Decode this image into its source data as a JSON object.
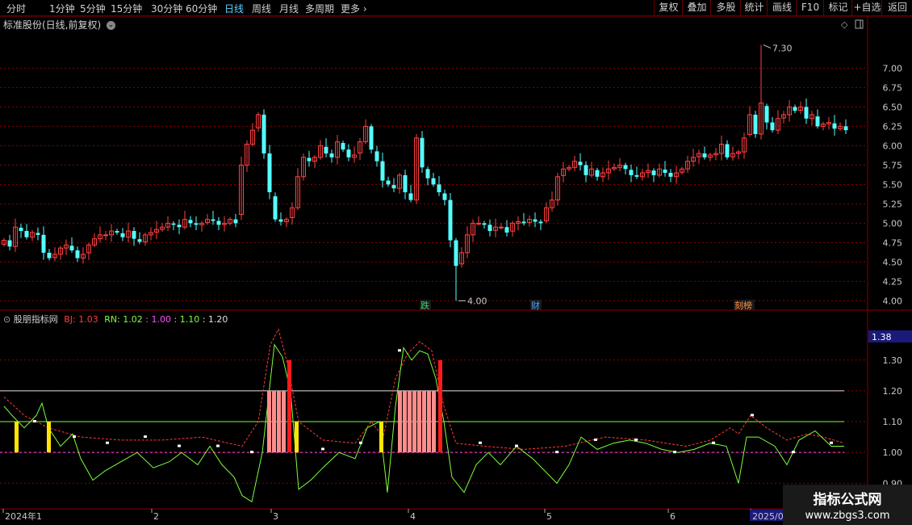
{
  "toolbar": {
    "periods": [
      "分时",
      "1分钟",
      "5分钟",
      "15分钟",
      "30分钟",
      "60分钟",
      "日线",
      "周线",
      "月线",
      "多周期",
      "更多"
    ],
    "active_period": "日线",
    "right_buttons": [
      "复权",
      "叠加",
      "多股",
      "统计",
      "画线",
      "F10",
      "标记",
      "+自选",
      "返回"
    ]
  },
  "main_chart": {
    "title": "标准股份(日线,前复权)",
    "price_labels": [
      "7.00",
      "6.75",
      "6.50",
      "6.25",
      "6.00",
      "5.75",
      "5.50",
      "5.25",
      "5.00",
      "4.75",
      "4.50",
      "4.25",
      "4.00"
    ],
    "high_mark": "7.30",
    "low_mark": "4.00",
    "event_tags": [
      {
        "text": "跌",
        "color": "#3fd36a"
      },
      {
        "text": "财",
        "color": "#4aa0ff"
      },
      {
        "text": "刻榜",
        "color": "#ff9040"
      }
    ]
  },
  "indicator": {
    "name": "股朋指标网",
    "bj_label": "BJ",
    "bj_value": "1.03",
    "rn_label": "RN",
    "rn_value": "1.02",
    "line1_value": "1.00",
    "line2_value": "1.10",
    "line3_value": "1.20",
    "current_value": "1.38",
    "scale_labels": [
      "1.30",
      "1.20",
      "1.10",
      "1.00",
      "0.90"
    ]
  },
  "time_axis": [
    "2024年1",
    "2",
    "3",
    "4",
    "5",
    "6",
    "2025/07"
  ],
  "watermark": {
    "line1": "指标公式网",
    "line2": "www.zbgs3.com"
  },
  "colors": {
    "up": "#ff4040",
    "down": "#54ffff",
    "grid": "#8a0000",
    "rn": "#7dff3c",
    "bj": "#ff3b3b"
  },
  "chart_data": [
    {
      "type": "candlestick",
      "title": "标准股份(日线,前复权)",
      "ylim": [
        3.9,
        7.4
      ],
      "y_ticks": [
        4.0,
        4.25,
        4.5,
        4.75,
        5.0,
        5.25,
        5.5,
        5.75,
        6.0,
        6.25,
        6.5,
        6.75,
        7.0
      ],
      "high": 7.3,
      "low": 4.0,
      "close": [
        4.78,
        4.7,
        4.95,
        4.9,
        4.82,
        4.88,
        4.85,
        4.62,
        4.55,
        4.6,
        4.68,
        4.72,
        4.65,
        4.55,
        4.6,
        4.72,
        4.8,
        4.85,
        4.85,
        4.9,
        4.88,
        4.82,
        4.9,
        4.8,
        4.76,
        4.85,
        4.88,
        4.92,
        4.95,
        5.0,
        4.98,
        4.95,
        5.05,
        5.0,
        4.98,
        5.0,
        5.05,
        5.03,
        4.98,
        5.0,
        5.05,
        5.0,
        5.75,
        6.02,
        6.2,
        6.4,
        5.9,
        5.4,
        5.05,
        5.02,
        5.05,
        5.2,
        5.6,
        5.85,
        5.8,
        5.85,
        6.0,
        5.9,
        5.85,
        6.05,
        5.95,
        5.85,
        5.88,
        6.05,
        6.25,
        5.95,
        5.8,
        5.55,
        5.5,
        5.45,
        5.62,
        5.4,
        5.3,
        6.1,
        5.72,
        5.58,
        5.5,
        5.4,
        5.3,
        4.78,
        4.45,
        4.62,
        4.85,
        5.0,
        5.0,
        4.98,
        4.9,
        4.95,
        4.95,
        4.88,
        5.0,
        5.02,
        5.0,
        5.05,
        5.02,
        5.0,
        5.2,
        5.3,
        5.6,
        5.7,
        5.72,
        5.8,
        5.75,
        5.62,
        5.7,
        5.6,
        5.65,
        5.7,
        5.72,
        5.75,
        5.7,
        5.62,
        5.6,
        5.65,
        5.68,
        5.62,
        5.7,
        5.65,
        5.6,
        5.65,
        5.7,
        5.8,
        5.85,
        5.9,
        5.85,
        5.88,
        5.9,
        6.02,
        5.85,
        5.9,
        5.92,
        6.1,
        6.4,
        6.15,
        6.55,
        6.3,
        6.2,
        6.35,
        6.4,
        6.5,
        6.45,
        6.5,
        6.35,
        6.4,
        6.25,
        6.28,
        6.3,
        6.22,
        6.25,
        6.2
      ]
    },
    {
      "type": "line",
      "title": "股朋指标网",
      "ylim": [
        0.83,
        1.42
      ],
      "series": [
        {
          "name": "BJ",
          "color": "#ff3b3b",
          "style": "dashed"
        },
        {
          "name": "RN",
          "color": "#7dff3c",
          "style": "solid"
        }
      ],
      "reference_lines": [
        1.0,
        1.1,
        1.2
      ],
      "current_value": 1.38
    }
  ]
}
